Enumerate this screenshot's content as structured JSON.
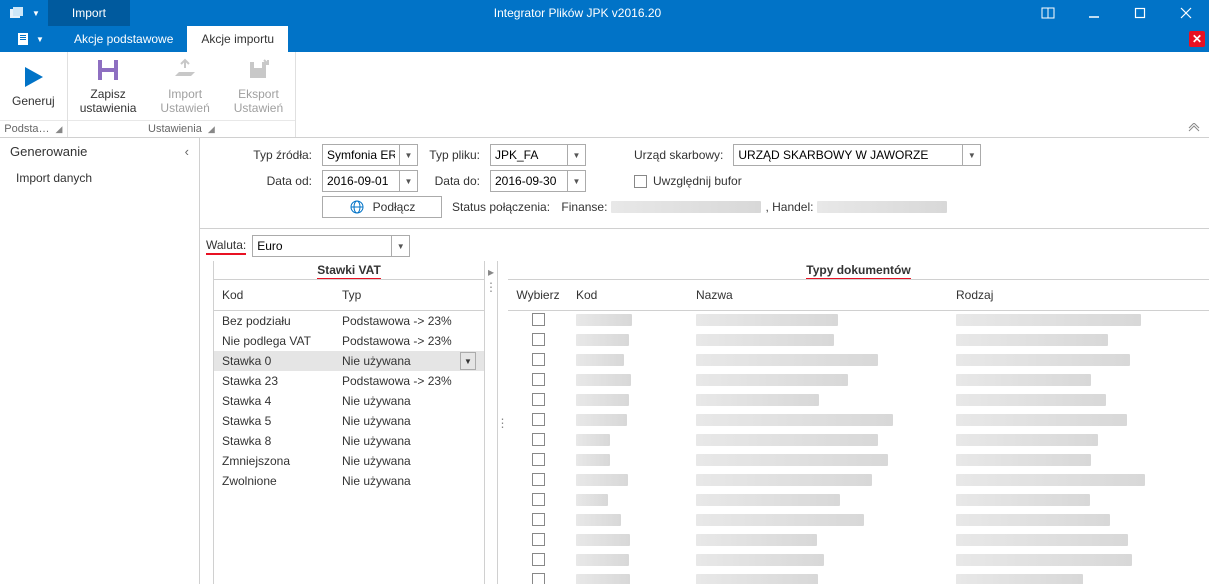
{
  "titlebar": {
    "active_context": "Import",
    "app_title": "Integrator Plików JPK v2016.20"
  },
  "tabs": {
    "basic": "Akcje podstawowe",
    "import": "Akcje importu"
  },
  "ribbon": {
    "generuj": {
      "label": "Generuj",
      "group": "Podsta…"
    },
    "zapisz": {
      "label": "Zapisz\nustawienia"
    },
    "import_ust": {
      "label": "Import\nUstawień"
    },
    "eksport_ust": {
      "label": "Eksport\nUstawień"
    },
    "ustawienia_group": "Ustawienia"
  },
  "sidepanel": {
    "title": "Generowanie",
    "item1": "Import danych"
  },
  "params": {
    "typ_zrodla_label": "Typ źródła:",
    "typ_zrodla_value": "Symfonia ERP",
    "typ_pliku_label": "Typ pliku:",
    "typ_pliku_value": "JPK_FA",
    "urzad_label": "Urząd skarbowy:",
    "urzad_value": "URZĄD SKARBOWY W JAWORZE",
    "data_od_label": "Data od:",
    "data_od_value": "2016-09-01",
    "data_do_label": "Data do:",
    "data_do_value": "2016-09-30",
    "bufor_label": "Uwzględnij bufor",
    "podlacz_label": "Podłącz",
    "status_label": "Status połączenia:",
    "status_finanse": "Finanse:",
    "status_handel": ", Handel:"
  },
  "waluta": {
    "label": "Waluta:",
    "value": "Euro"
  },
  "stawki": {
    "title": "Stawki VAT",
    "cols": {
      "kod": "Kod",
      "typ": "Typ"
    },
    "rows": [
      {
        "kod": "Bez podziału",
        "typ": "Podstawowa -> 23%"
      },
      {
        "kod": "Nie podlega VAT",
        "typ": "Podstawowa -> 23%"
      },
      {
        "kod": "Stawka 0",
        "typ": "Nie używana",
        "selected": true,
        "dd": true
      },
      {
        "kod": "Stawka 23",
        "typ": "Podstawowa -> 23%"
      },
      {
        "kod": "Stawka 4",
        "typ": "Nie używana"
      },
      {
        "kod": "Stawka 5",
        "typ": "Nie używana"
      },
      {
        "kod": "Stawka 8",
        "typ": "Nie używana"
      },
      {
        "kod": "Zmniejszona",
        "typ": "Nie używana"
      },
      {
        "kod": "Zwolnione",
        "typ": "Nie używana"
      }
    ]
  },
  "typy": {
    "title": "Typy dokumentów",
    "cols": {
      "wybierz": "Wybierz",
      "kod": "Kod",
      "nazwa": "Nazwa",
      "rodzaj": "Rodzaj"
    },
    "row_count": 14
  }
}
